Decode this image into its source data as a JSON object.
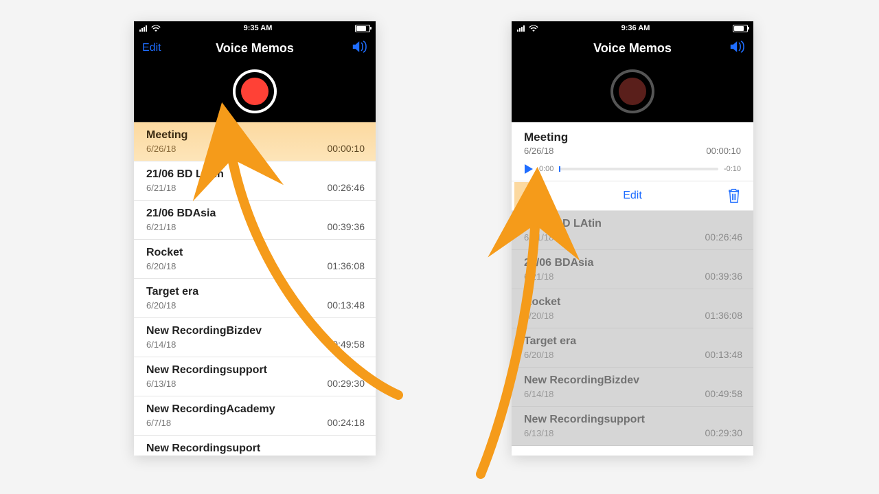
{
  "left": {
    "statusbar": {
      "time": "9:35 AM"
    },
    "navbar": {
      "edit": "Edit",
      "title": "Voice Memos"
    },
    "memos": [
      {
        "title": "Meeting",
        "date": "6/26/18",
        "duration": "00:00:10",
        "highlight": true
      },
      {
        "title": "21/06 BD LAtin",
        "date": "6/21/18",
        "duration": "00:26:46"
      },
      {
        "title": "21/06 BDAsia",
        "date": "6/21/18",
        "duration": "00:39:36"
      },
      {
        "title": "Rocket",
        "date": "6/20/18",
        "duration": "01:36:08"
      },
      {
        "title": "Target era",
        "date": "6/20/18",
        "duration": "00:13:48"
      },
      {
        "title": "New RecordingBizdev",
        "date": "6/14/18",
        "duration": "00:49:58"
      },
      {
        "title": "New Recordingsupport",
        "date": "6/13/18",
        "duration": "00:29:30"
      },
      {
        "title": "New RecordingAcademy",
        "date": "6/7/18",
        "duration": "00:24:18"
      },
      {
        "title": "New Recordingsuport",
        "date": "",
        "duration": "",
        "cut": true
      }
    ]
  },
  "right": {
    "statusbar": {
      "time": "9:36 AM"
    },
    "navbar": {
      "title": "Voice Memos"
    },
    "selected": {
      "title": "Meeting",
      "date": "6/26/18",
      "duration": "00:00:10",
      "elapsed": "0:00",
      "remaining": "-0:10"
    },
    "editbar": {
      "edit": "Edit"
    },
    "memos": [
      {
        "title": "21/06 BD LAtin",
        "date": "6/21/18",
        "duration": "00:26:46"
      },
      {
        "title": "21/06 BDAsia",
        "date": "6/21/18",
        "duration": "00:39:36"
      },
      {
        "title": "Rocket",
        "date": "6/20/18",
        "duration": "01:36:08"
      },
      {
        "title": "Target era",
        "date": "6/20/18",
        "duration": "00:13:48"
      },
      {
        "title": "New RecordingBizdev",
        "date": "6/14/18",
        "duration": "00:49:58"
      },
      {
        "title": "New Recordingsupport",
        "date": "6/13/18",
        "duration": "00:29:30"
      }
    ]
  }
}
